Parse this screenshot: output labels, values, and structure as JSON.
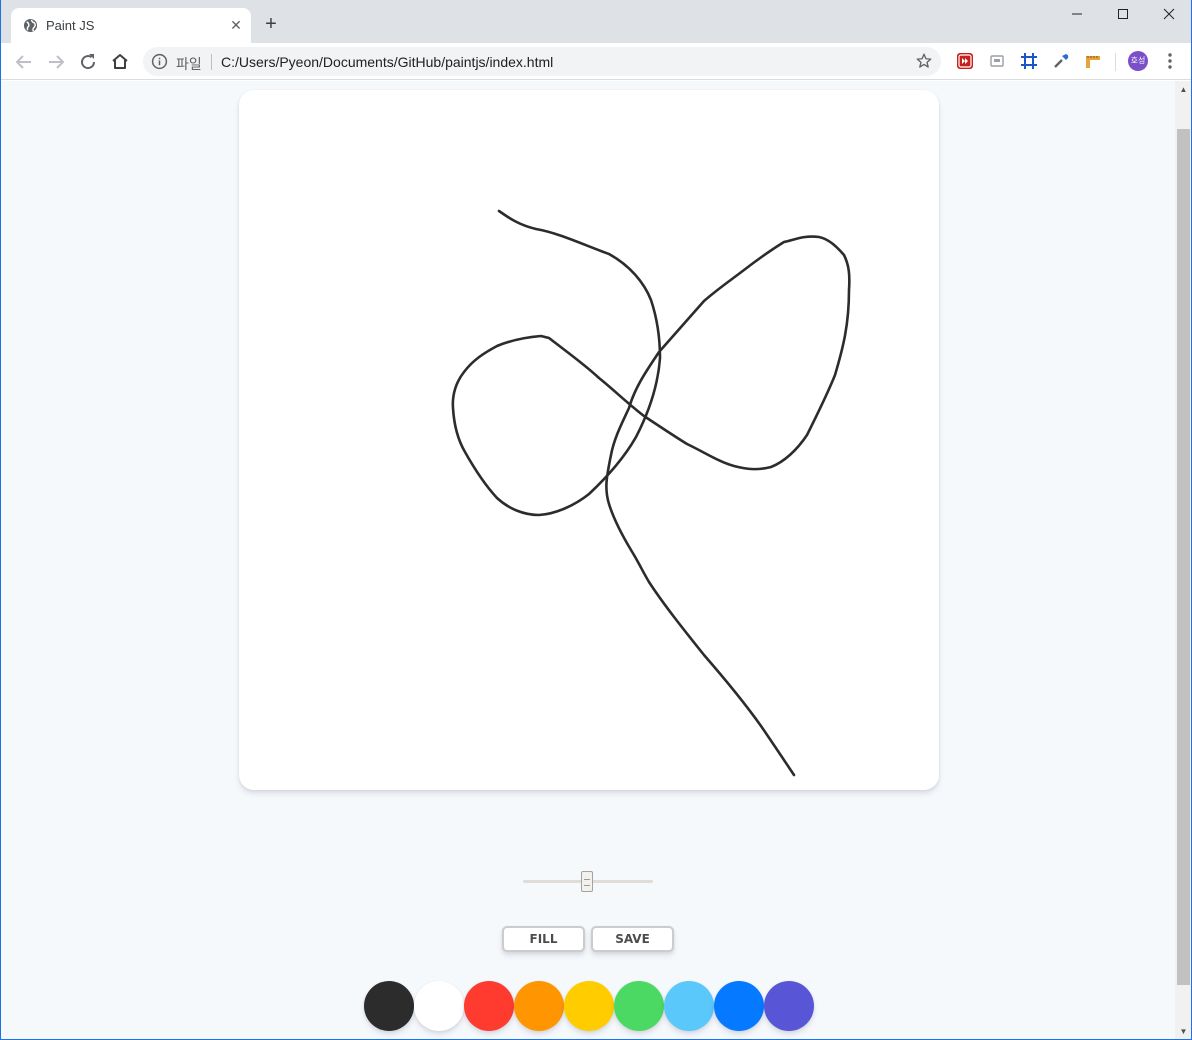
{
  "browser": {
    "tab": {
      "title": "Paint JS",
      "favicon": "globe-icon"
    },
    "new_tab": "+",
    "window_controls": {
      "minimize": "minimize-icon",
      "maximize": "maximize-icon",
      "close": "close-icon"
    },
    "address_bar": {
      "scheme_label": "파일",
      "url": "C:/Users/Pyeon/Documents/GitHub/paintjs/index.html"
    },
    "profile": {
      "initials": "호성",
      "color": "#7b4fc9"
    },
    "extensions": [
      "fast-forward-icon",
      "screenshot-icon",
      "grid-crop-icon",
      "eyedropper-icon",
      "ruler-icon"
    ]
  },
  "app": {
    "controls": {
      "fill_label": "Fill",
      "save_label": "Save",
      "brush_size_range": {
        "value": 2.5,
        "min": 0.1,
        "max": 5.0
      }
    },
    "palette": [
      {
        "name": "black",
        "color": "#2c2c2c"
      },
      {
        "name": "white",
        "color": "#ffffff"
      },
      {
        "name": "red",
        "color": "#ff3b30"
      },
      {
        "name": "orange",
        "color": "#ff9500"
      },
      {
        "name": "yellow",
        "color": "#ffcc00"
      },
      {
        "name": "green",
        "color": "#4cd963"
      },
      {
        "name": "sky-blue",
        "color": "#5ac8fa"
      },
      {
        "name": "blue",
        "color": "#0579ff"
      },
      {
        "name": "purple",
        "color": "#5856d6"
      }
    ],
    "stroke_color": "#2c2c2c"
  }
}
